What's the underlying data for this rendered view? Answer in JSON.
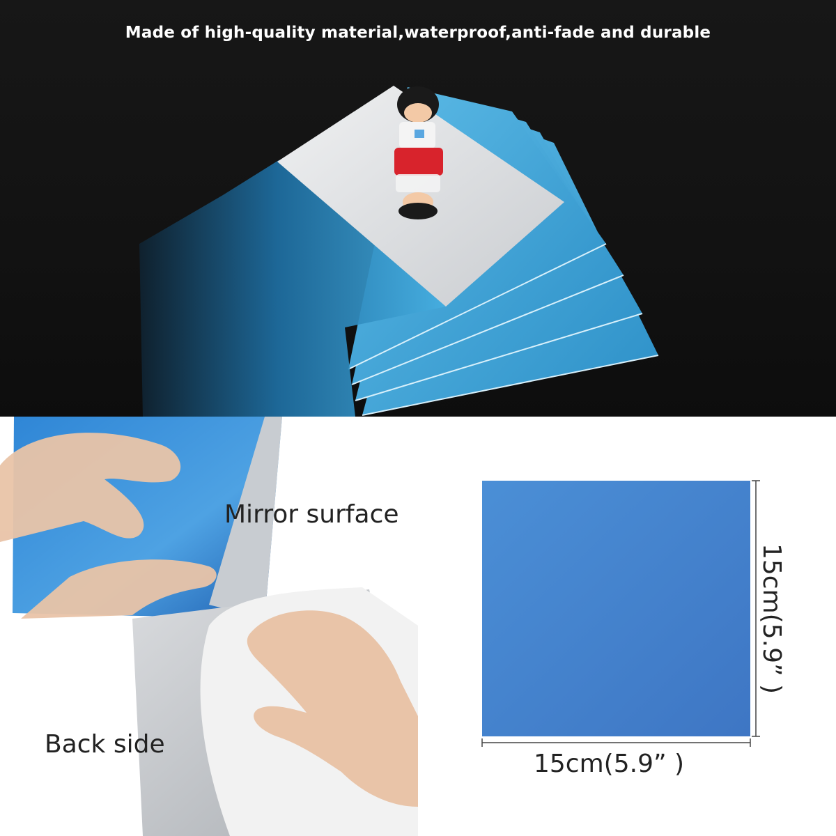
{
  "headline": "Made of high-quality material,waterproof,anti-fade and durable",
  "labels": {
    "mirror_surface": "Mirror surface",
    "back_side": "Back side"
  },
  "dimensions": {
    "width": "15cm(5.9” )",
    "height": "15cm(5.9” )"
  },
  "colors": {
    "background_top": "#121212",
    "film_blue": "#3aa0d8",
    "sheet_blue": "#4a86cc",
    "mirror_back": "#e6e8ea"
  }
}
